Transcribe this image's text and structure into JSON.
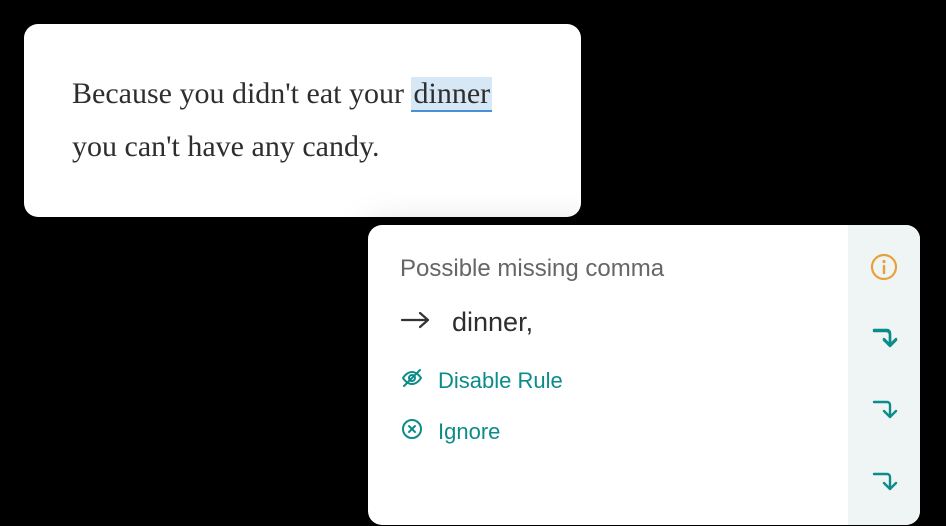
{
  "editor": {
    "text_before": "Because you didn't eat your ",
    "highlighted": "dinner",
    "text_after": " you can't have any candy."
  },
  "suggestion": {
    "title": "Possible missing comma",
    "replacement": "dinner,",
    "disable_label": "Disable Rule",
    "ignore_label": "Ignore"
  }
}
